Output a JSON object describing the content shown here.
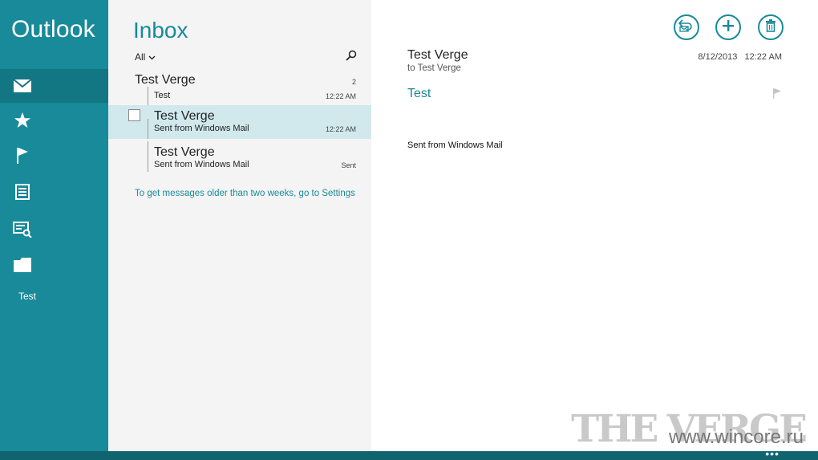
{
  "app": {
    "title": "Outlook"
  },
  "sidebar": {
    "items": [
      {
        "icon": "mail-icon",
        "active": true
      },
      {
        "icon": "star-icon",
        "active": false
      },
      {
        "icon": "flag-icon",
        "active": false
      },
      {
        "icon": "newsletter-icon",
        "active": false
      },
      {
        "icon": "social-updates-icon",
        "active": false
      },
      {
        "icon": "folder-icon",
        "active": false
      }
    ],
    "folder_label": "Test"
  },
  "list": {
    "title": "Inbox",
    "filter": "All",
    "messages": [
      {
        "from": "Test Verge",
        "preview": "Test",
        "count": "2",
        "time": "12:22 AM"
      },
      {
        "from": "Test Verge",
        "preview": "Sent from Windows Mail",
        "time": "12:22 AM",
        "selected": true
      },
      {
        "from": "Test Verge",
        "preview": "Sent from Windows Mail",
        "time": "Sent"
      }
    ],
    "older_link": "To get messages older than two weeks, go to Settings"
  },
  "reading": {
    "from": "Test Verge",
    "to": "to Test Verge",
    "date": "8/12/2013",
    "time": "12:22 AM",
    "subject": "Test",
    "body": "Sent from Windows Mail",
    "actions": [
      "reply-icon",
      "new-mail-icon",
      "delete-icon"
    ]
  },
  "watermark": {
    "brand": "THE VERGE",
    "site": "www.wincore.ru"
  },
  "appbar": {
    "more": "•••"
  },
  "colors": {
    "accent": "#188a99",
    "sidebar_active": "#137683",
    "appbar": "#0f6470",
    "list_bg": "#f4f4f4",
    "selected_bg": "#d1e9ed"
  }
}
